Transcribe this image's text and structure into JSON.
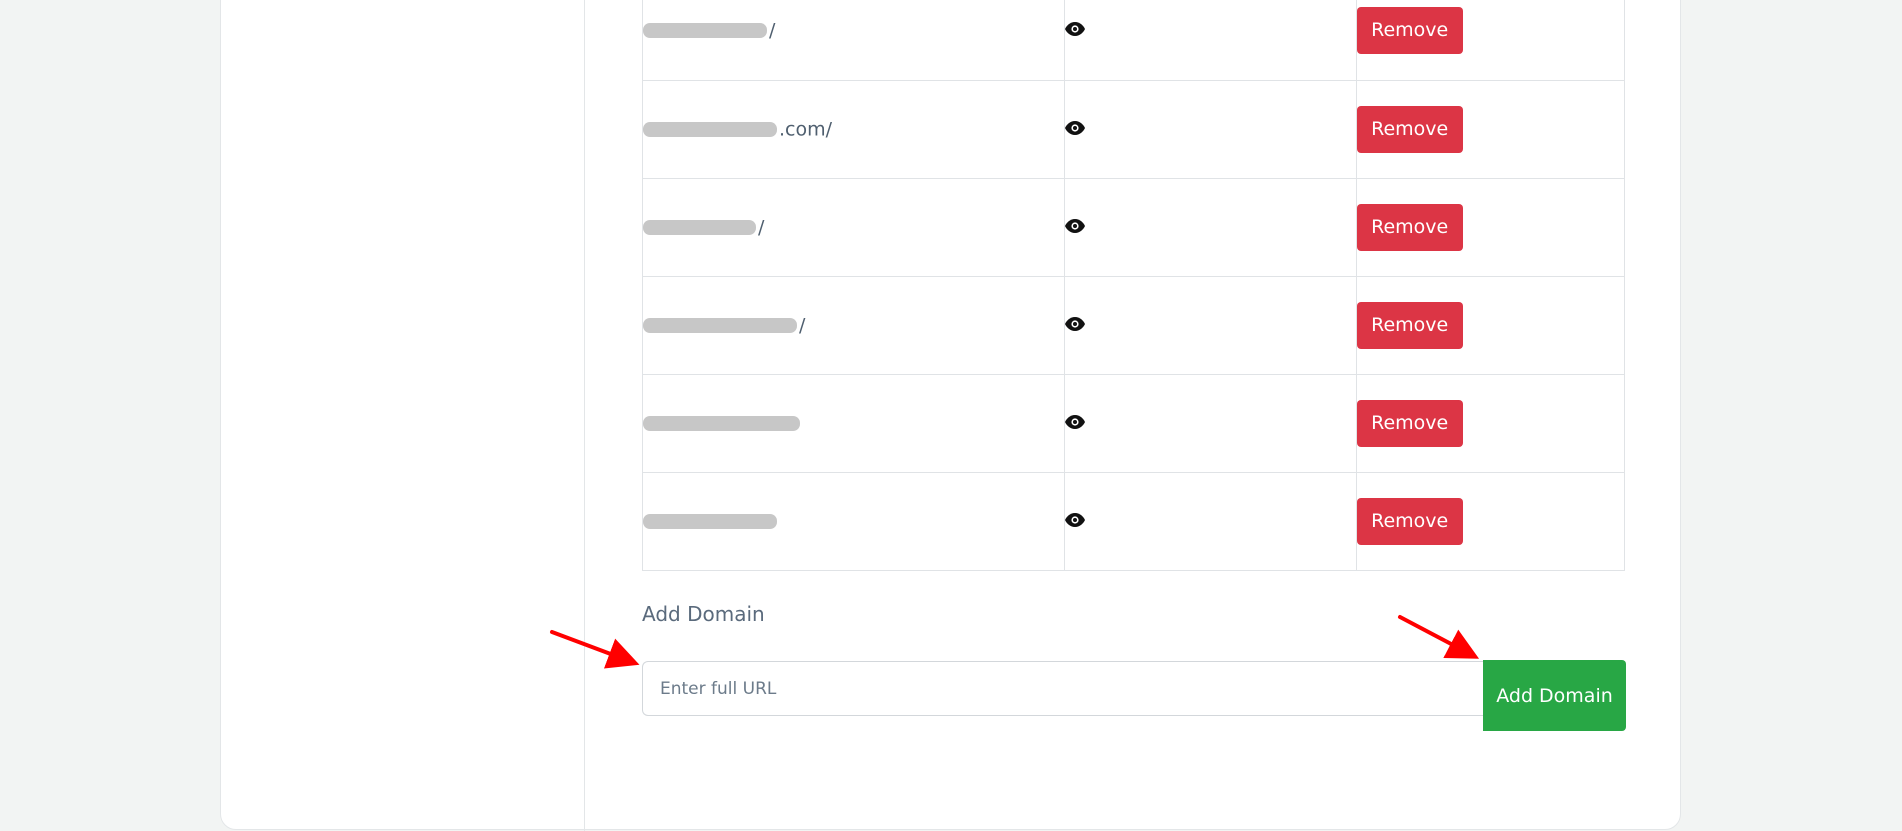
{
  "domains": [
    {
      "visible_text": "/",
      "view_icon": "eye-icon",
      "remove_label": "Remove"
    },
    {
      "visible_text": ".com/",
      "view_icon": "eye-icon",
      "remove_label": "Remove"
    },
    {
      "visible_text": "/",
      "view_icon": "eye-icon",
      "remove_label": "Remove"
    },
    {
      "visible_text": "/",
      "view_icon": "eye-icon",
      "remove_label": "Remove"
    },
    {
      "visible_text": "",
      "view_icon": "eye-icon",
      "remove_label": "Remove"
    },
    {
      "visible_text": "",
      "view_icon": "eye-icon",
      "remove_label": "Remove"
    }
  ],
  "add_domain": {
    "label": "Add Domain",
    "input_placeholder": "Enter full URL",
    "input_value": "",
    "button_label": "Add Domain"
  },
  "colors": {
    "remove_button": "#dc3545",
    "add_button": "#28a745",
    "annotation_arrow": "#ff0000",
    "page_background": "#f2f4f3"
  },
  "annotations": [
    {
      "type": "arrow",
      "points_to": "url-input"
    },
    {
      "type": "arrow",
      "points_to": "add-domain-button"
    }
  ]
}
